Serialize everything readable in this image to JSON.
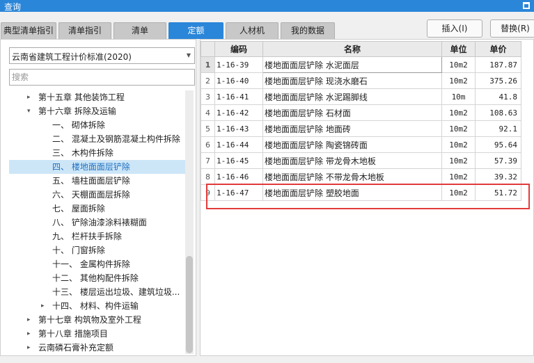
{
  "window": {
    "title": "查询"
  },
  "tabs": [
    {
      "label": "典型清单指引",
      "active": false
    },
    {
      "label": "清单指引",
      "active": false
    },
    {
      "label": "清单",
      "active": false
    },
    {
      "label": "定额",
      "active": true
    },
    {
      "label": "人材机",
      "active": false
    },
    {
      "label": "我的数据",
      "active": false
    }
  ],
  "buttons": {
    "insert": "插入(I)",
    "replace": "替换(R)"
  },
  "library": {
    "selected": "云南省建筑工程计价标准(2020)"
  },
  "search": {
    "placeholder": "搜索",
    "value": ""
  },
  "tree": [
    {
      "label": "第十五章 其他装饰工程",
      "level": 1,
      "expander": "▸",
      "selected": false
    },
    {
      "label": "第十六章 拆除及运输",
      "level": 1,
      "expander": "▾",
      "selected": false
    },
    {
      "label": "一、 砌体拆除",
      "level": 2,
      "expander": "",
      "selected": false
    },
    {
      "label": "二、 混凝土及钢筋混凝土构件拆除",
      "level": 2,
      "expander": "",
      "selected": false
    },
    {
      "label": "三、 木构件拆除",
      "level": 2,
      "expander": "",
      "selected": false
    },
    {
      "label": "四、 楼地面面层铲除",
      "level": 2,
      "expander": "",
      "selected": true
    },
    {
      "label": "五、 墙柱面面层铲除",
      "level": 2,
      "expander": "",
      "selected": false
    },
    {
      "label": "六、 天棚面面层拆除",
      "level": 2,
      "expander": "",
      "selected": false
    },
    {
      "label": "七、 屋面拆除",
      "level": 2,
      "expander": "",
      "selected": false
    },
    {
      "label": "八、 铲除油漆涂料裱糊面",
      "level": 2,
      "expander": "",
      "selected": false
    },
    {
      "label": "九、 栏杆扶手拆除",
      "level": 2,
      "expander": "",
      "selected": false
    },
    {
      "label": "十、 门窗拆除",
      "level": 2,
      "expander": "",
      "selected": false
    },
    {
      "label": "十一、 金属构件拆除",
      "level": 2,
      "expander": "",
      "selected": false
    },
    {
      "label": "十二、 其他构配件拆除",
      "level": 2,
      "expander": "",
      "selected": false
    },
    {
      "label": "十三、 楼层运出垃圾、建筑垃圾...",
      "level": 2,
      "expander": "",
      "selected": false
    },
    {
      "label": "十四、 材料、构件运输",
      "level": 2,
      "expander": "▸",
      "selected": false
    },
    {
      "label": "第十七章 构筑物及室外工程",
      "level": 1,
      "expander": "▸",
      "selected": false
    },
    {
      "label": "第十八章 措施项目",
      "level": 1,
      "expander": "▸",
      "selected": false
    },
    {
      "label": "云南磷石膏补充定额",
      "level": 1,
      "expander": "▸",
      "selected": false
    }
  ],
  "table": {
    "headers": [
      "",
      "编码",
      "名称",
      "单位",
      "单价"
    ],
    "rows": [
      {
        "num": "1",
        "code": "1-16-39",
        "name": "楼地面面层铲除 水泥面层",
        "unit": "10m2",
        "price": "187.87"
      },
      {
        "num": "2",
        "code": "1-16-40",
        "name": "楼地面面层铲除 现浇水磨石",
        "unit": "10m2",
        "price": "375.26"
      },
      {
        "num": "3",
        "code": "1-16-41",
        "name": "楼地面面层铲除 水泥踢脚线",
        "unit": "10m",
        "price": "41.8"
      },
      {
        "num": "4",
        "code": "1-16-42",
        "name": "楼地面面层铲除 石材面",
        "unit": "10m2",
        "price": "108.63"
      },
      {
        "num": "5",
        "code": "1-16-43",
        "name": "楼地面面层铲除 地面砖",
        "unit": "10m2",
        "price": "92.1"
      },
      {
        "num": "6",
        "code": "1-16-44",
        "name": "楼地面面层铲除 陶瓷锦砖面",
        "unit": "10m2",
        "price": "95.64"
      },
      {
        "num": "7",
        "code": "1-16-45",
        "name": "楼地面面层铲除 带龙骨木地板",
        "unit": "10m2",
        "price": "57.39"
      },
      {
        "num": "8",
        "code": "1-16-46",
        "name": "楼地面面层铲除 不带龙骨木地板",
        "unit": "10m2",
        "price": "39.32"
      },
      {
        "num": "9",
        "code": "1-16-47",
        "name": "楼地面面层铲除 塑胶地面",
        "unit": "10m2",
        "price": "51.72"
      }
    ]
  },
  "colors": {
    "accent": "#2a86d9",
    "selection": "#cde6f7",
    "highlight": "#e23a3a"
  }
}
